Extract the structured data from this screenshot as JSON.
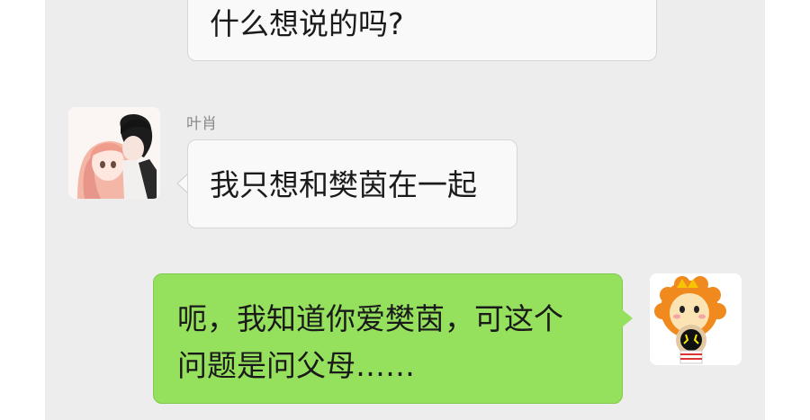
{
  "messages": [
    {
      "sender": "",
      "text": "什么想说的吗?"
    },
    {
      "sender": "叶肖",
      "text": "我只想和樊茵在一起",
      "avatar": "couple-anime-avatar"
    },
    {
      "sender": "",
      "text": "呃，我知道你爱樊茵，可这个\n问题是问父母……",
      "avatar": "lion-mascot-avatar"
    }
  ],
  "colors": {
    "chat_background": "#ededed",
    "incoming_bubble": "#f9f9f9",
    "outgoing_bubble": "#95e15e"
  }
}
